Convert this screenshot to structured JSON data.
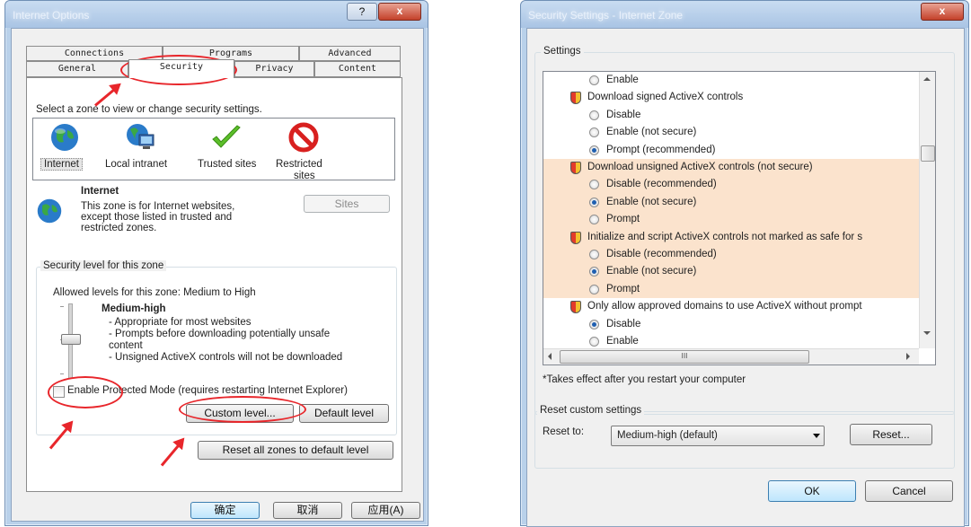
{
  "left_window": {
    "title": "Internet Options",
    "help_button": "?",
    "close_button": "x",
    "tabs_row1": [
      "Connections",
      "Programs",
      "Advanced"
    ],
    "tabs_row2": [
      "General",
      "Security",
      "Privacy",
      "Content"
    ],
    "zone_prompt": "Select a zone to view or change security settings.",
    "zones": [
      {
        "label": "Internet",
        "icon": "globe-icon"
      },
      {
        "label": "Local intranet",
        "icon": "intranet-icon"
      },
      {
        "label": "Trusted sites",
        "icon": "checkmark-icon"
      },
      {
        "label": "Restricted sites",
        "label_line1": "Restricted",
        "label_line2": "sites",
        "icon": "restricted-icon"
      }
    ],
    "zone_info": {
      "title": "Internet",
      "lines": [
        "This zone is for Internet websites,",
        "except those listed in trusted and",
        "restricted zones."
      ]
    },
    "sites_button": "Sites",
    "security_group": {
      "legend": "Security level for this zone",
      "allowed": "Allowed levels for this zone: Medium to High",
      "level": "Medium-high",
      "bullets": [
        "- Appropriate for most websites",
        "- Prompts before downloading potentially unsafe",
        "content",
        "- Unsigned ActiveX controls will not be downloaded"
      ],
      "protected_mode": "Enable Protected Mode (requires restarting Internet Explorer)",
      "protected_mode_checked": false,
      "custom_level": "Custom level...",
      "default_level": "Default level"
    },
    "reset_all": "Reset all zones to default level",
    "buttons": {
      "ok": "确定",
      "cancel": "取消",
      "apply": "应用(A)"
    }
  },
  "right_window": {
    "title": "Security Settings - Internet Zone",
    "close_button": "x",
    "settings_legend": "Settings",
    "highlight_color": "#fbe3cd",
    "items": [
      {
        "type": "option",
        "text": "Enable",
        "selected": false,
        "hl": false
      },
      {
        "type": "header",
        "text": "Download signed ActiveX controls",
        "hl": false
      },
      {
        "type": "option",
        "text": "Disable",
        "selected": false,
        "hl": false
      },
      {
        "type": "option",
        "text": "Enable (not secure)",
        "selected": false,
        "hl": false
      },
      {
        "type": "option",
        "text": "Prompt (recommended)",
        "selected": true,
        "hl": false
      },
      {
        "type": "header",
        "text": "Download unsigned ActiveX controls (not secure)",
        "hl": true
      },
      {
        "type": "option",
        "text": "Disable (recommended)",
        "selected": false,
        "hl": true
      },
      {
        "type": "option",
        "text": "Enable (not secure)",
        "selected": true,
        "hl": true
      },
      {
        "type": "option",
        "text": "Prompt",
        "selected": false,
        "hl": true
      },
      {
        "type": "header",
        "text": "Initialize and script ActiveX controls not marked as safe for s",
        "hl": true
      },
      {
        "type": "option",
        "text": "Disable (recommended)",
        "selected": false,
        "hl": true
      },
      {
        "type": "option",
        "text": "Enable (not secure)",
        "selected": true,
        "hl": true
      },
      {
        "type": "option",
        "text": "Prompt",
        "selected": false,
        "hl": true
      },
      {
        "type": "header",
        "text": "Only allow approved domains to use ActiveX without prompt",
        "hl": false
      },
      {
        "type": "option",
        "text": "Disable",
        "selected": true,
        "hl": false
      },
      {
        "type": "option",
        "text": "Enable",
        "selected": false,
        "hl": false
      }
    ],
    "hscroll_mark": "III",
    "note": "*Takes effect after you restart your computer",
    "reset_group": {
      "legend": "Reset custom settings",
      "reset_to_label": "Reset to:",
      "select_value": "Medium-high (default)",
      "reset_button": "Reset..."
    },
    "ok": "OK",
    "cancel": "Cancel"
  }
}
